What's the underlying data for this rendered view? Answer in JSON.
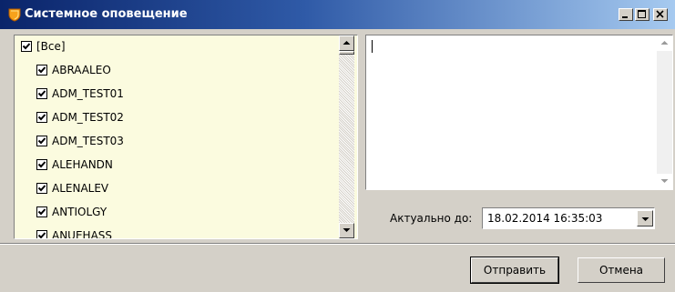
{
  "window": {
    "title": "Системное оповещение",
    "icon": "shield-icon"
  },
  "list": {
    "items": [
      {
        "label": "[Все]",
        "checked": true
      },
      {
        "label": "ABRAALEO",
        "checked": true
      },
      {
        "label": "ADM_TEST01",
        "checked": true
      },
      {
        "label": "ADM_TEST02",
        "checked": true
      },
      {
        "label": "ADM_TEST03",
        "checked": true
      },
      {
        "label": "ALEHANDN",
        "checked": true
      },
      {
        "label": "ALENALEV",
        "checked": true
      },
      {
        "label": "ANTIOLGY",
        "checked": true
      },
      {
        "label": "ANUEHASS",
        "checked": true
      }
    ]
  },
  "message": {
    "text": ""
  },
  "actual": {
    "label": "Актуально до:",
    "value": "18.02.2014 16:35:03"
  },
  "buttons": {
    "send": "Отправить",
    "cancel": "Отмена"
  },
  "colors": {
    "list_background": "#fbfbdf",
    "title_start": "#0a246a",
    "title_end": "#a6caf0"
  }
}
